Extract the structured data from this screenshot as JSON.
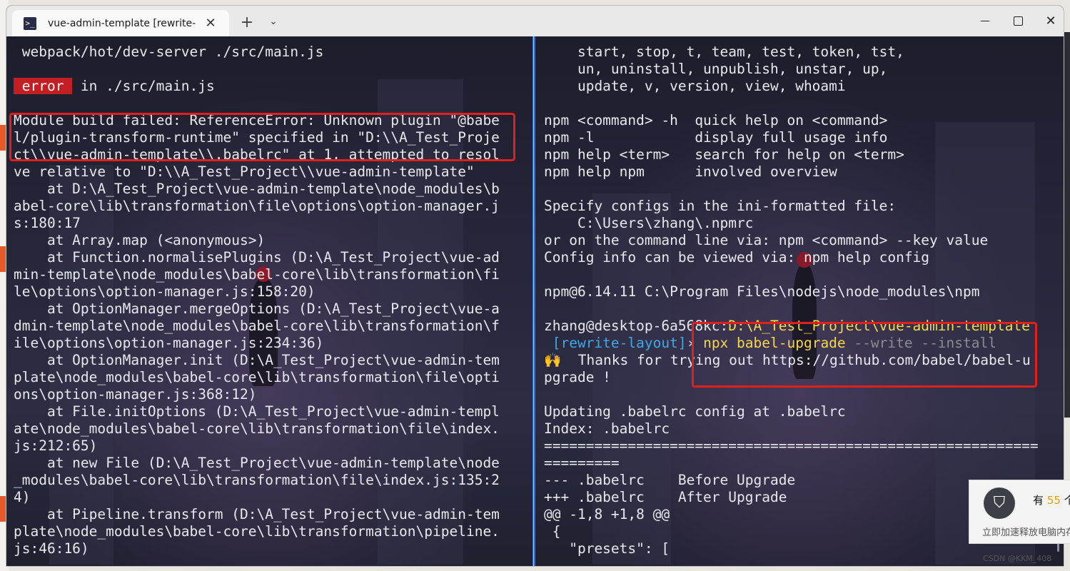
{
  "window": {
    "tab_title": "vue-admin-template [rewrite-",
    "tab_icon": "terminal-icon",
    "new_tab_label": "+",
    "dropdown_label": "⌄",
    "close_tab_label": "✕",
    "close_label": "✕"
  },
  "left_terminal": {
    "l1": " webpack/hot/dev-server ./src/main.js",
    "error_badge": " error ",
    "l3_rest": " in ./src/main.js",
    "lines": [
      "Module build failed: ReferenceError: Unknown plugin \"@babe",
      "l/plugin-transform-runtime\" specified in \"D:\\\\A_Test_Proje",
      "ct\\\\vue-admin-template\\\\.babelrc\" at 1, attempted to resol",
      "ve relative to \"D:\\\\A_Test_Project\\\\vue-admin-template\"",
      "    at D:\\A_Test_Project\\vue-admin-template\\node_modules\\b",
      "abel-core\\lib\\transformation\\file\\options\\option-manager.j",
      "s:180:17",
      "    at Array.map (<anonymous>)",
      "    at Function.normalisePlugins (D:\\A_Test_Project\\vue-ad",
      "min-template\\node_modules\\babel-core\\lib\\transformation\\fi",
      "le\\options\\option-manager.js:158:20)",
      "    at OptionManager.mergeOptions (D:\\A_Test_Project\\vue-a",
      "dmin-template\\node_modules\\babel-core\\lib\\transformation\\f",
      "ile\\options\\option-manager.js:234:36)",
      "    at OptionManager.init (D:\\A_Test_Project\\vue-admin-tem",
      "plate\\node_modules\\babel-core\\lib\\transformation\\file\\opti",
      "ons\\option-manager.js:368:12)",
      "    at File.initOptions (D:\\A_Test_Project\\vue-admin-templ",
      "ate\\node_modules\\babel-core\\lib\\transformation\\file\\index.",
      "js:212:65)",
      "    at new File (D:\\A_Test_Project\\vue-admin-template\\node",
      "_modules\\babel-core\\lib\\transformation\\file\\index.js:135:2",
      "4)",
      "    at Pipeline.transform (D:\\A_Test_Project\\vue-admin-tem",
      "plate\\node_modules\\babel-core\\lib\\transformation\\pipeline.",
      "js:46:16)"
    ]
  },
  "right_terminal": {
    "top_lines": [
      "    start, stop, t, team, test, token, tst,",
      "    un, uninstall, unpublish, unstar, up,",
      "    update, v, version, view, whoami",
      "",
      "npm <command> -h  quick help on <command>",
      "npm -l            display full usage info",
      "npm help <term>   search for help on <term>",
      "npm help npm      involved overview",
      "",
      "Specify configs in the ini-formatted file:",
      "    C:\\Users\\zhang\\.npmrc",
      "or on the command line via: npm <command> --key value",
      "Config info can be viewed via: npm help config",
      "",
      "npm@6.14.11 C:\\Program Files\\nodejs\\node_modules\\npm",
      ""
    ],
    "prompt_user": "zhang@desktop-6a568kc:",
    "prompt_path": "D:\\A_Test_Project\\vue-admin-template",
    "prompt_branch": " [rewrite-layout]",
    "prompt_arrow": "› ",
    "cmd": "npx babel-upgrade",
    "cmd_flags": " --write --install",
    "thanks_emoji": "🙌",
    "thanks": "  Thanks for trying out https://github.com/babel/babel-u",
    "thanks_cont": "pgrade !",
    "bottom_lines": [
      "",
      "Updating .babelrc config at .babelrc",
      "Index: .babelrc",
      "===========================================================",
      "=========",
      "--- .babelrc    Before Upgrade",
      "+++ .babelrc    After Upgrade",
      "@@ -1,8 +1,8 @@",
      " {",
      "   \"presets\": ["
    ]
  },
  "notification": {
    "title_prefix": "有 ",
    "count": "55",
    "title_suffix": " 个",
    "action": "立即加速释放电脑内存"
  },
  "watermark": "CSDN @KKM_408"
}
